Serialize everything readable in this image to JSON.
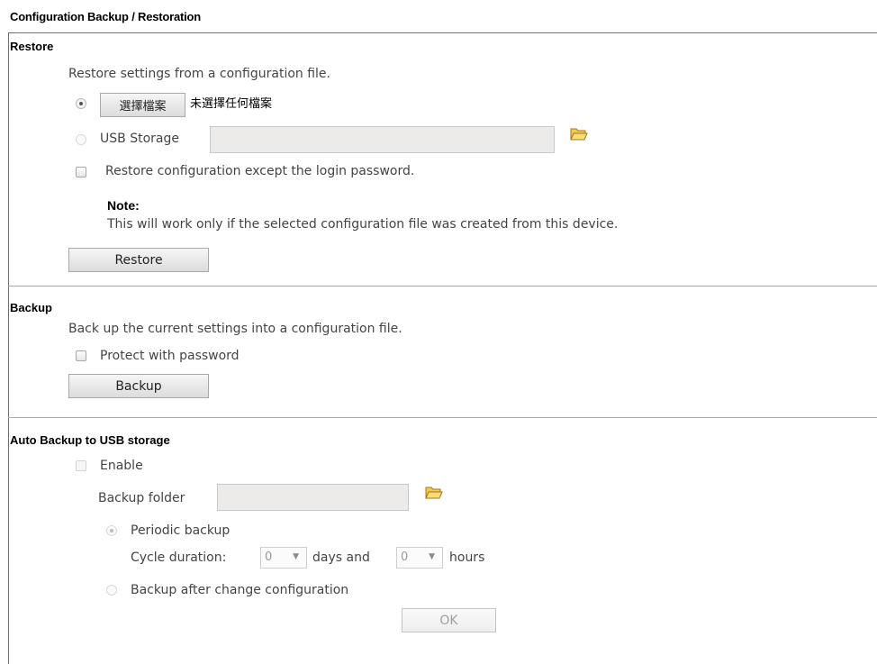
{
  "page_title": "Configuration Backup / Restoration",
  "restore": {
    "section_title": "Restore",
    "description": "Restore settings from a configuration file.",
    "choose_file_button": "選擇檔案",
    "no_file_text": "未選擇任何檔案",
    "usb_storage_label": "USB Storage",
    "usb_storage_value": "",
    "except_password_label": "Restore configuration except the login password.",
    "note_label": "Note:",
    "note_text": "This will work only if the selected configuration file was created from this device.",
    "restore_button": "Restore"
  },
  "backup": {
    "section_title": "Backup",
    "description": "Back up the current settings into a configuration file.",
    "protect_label": "Protect with password",
    "backup_button": "Backup"
  },
  "auto_backup": {
    "section_title": "Auto Backup to USB storage",
    "enable_label": "Enable",
    "folder_label": "Backup folder",
    "folder_value": "",
    "periodic_label": "Periodic backup",
    "cycle_label": "Cycle duration:",
    "days_value": "0",
    "days_label": "days and",
    "hours_value": "0",
    "hours_label": "hours",
    "after_change_label": "Backup after change configuration",
    "ok_button": "OK"
  },
  "icons": {
    "folder": "folder-open-icon"
  }
}
